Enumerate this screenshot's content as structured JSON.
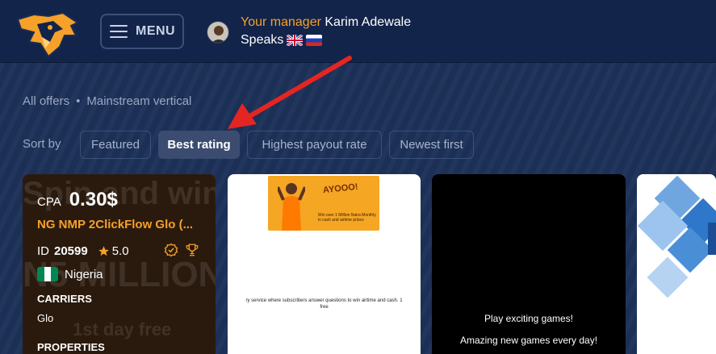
{
  "header": {
    "menu_label": "MENU",
    "manager_label": "Your manager",
    "manager_name": "Karim Adewale",
    "speaks_label": "Speaks"
  },
  "breadcrumb": {
    "items": [
      "All offers",
      "Mainstream vertical"
    ],
    "separator": "•"
  },
  "sort": {
    "label": "Sort by",
    "options": [
      "Featured",
      "Best rating",
      "Highest payout rate",
      "Newest first"
    ],
    "active": "Best rating"
  },
  "offers": [
    {
      "cpa_label": "CPA",
      "payout": "0.30$",
      "name": "NG NMP 2ClickFlow Glo (...",
      "id_label": "ID",
      "id": "20599",
      "rating": "5.0",
      "country": "Nigeria",
      "carriers_label": "CARRIERS",
      "carrier": "Glo",
      "properties_label": "PROPERTIES",
      "bg_text": [
        "Spin and win",
        "N5 MILLION",
        "1st day free"
      ]
    },
    {
      "promo_title": "AYOOO!",
      "promo_text": "Win over 1 Million Naira Monthly in cash and airtime prizes",
      "description": "ry service where subscribers answer questions to win airtime and cash. 1",
      "description2": "free"
    },
    {
      "line1": "Play exciting games!",
      "line2": "Amazing new games every day!"
    },
    {}
  ],
  "colors": {
    "accent": "#f6a12a",
    "header_bg": "#12244a",
    "page_bg": "#1d3159",
    "arrow": "#e52521"
  }
}
